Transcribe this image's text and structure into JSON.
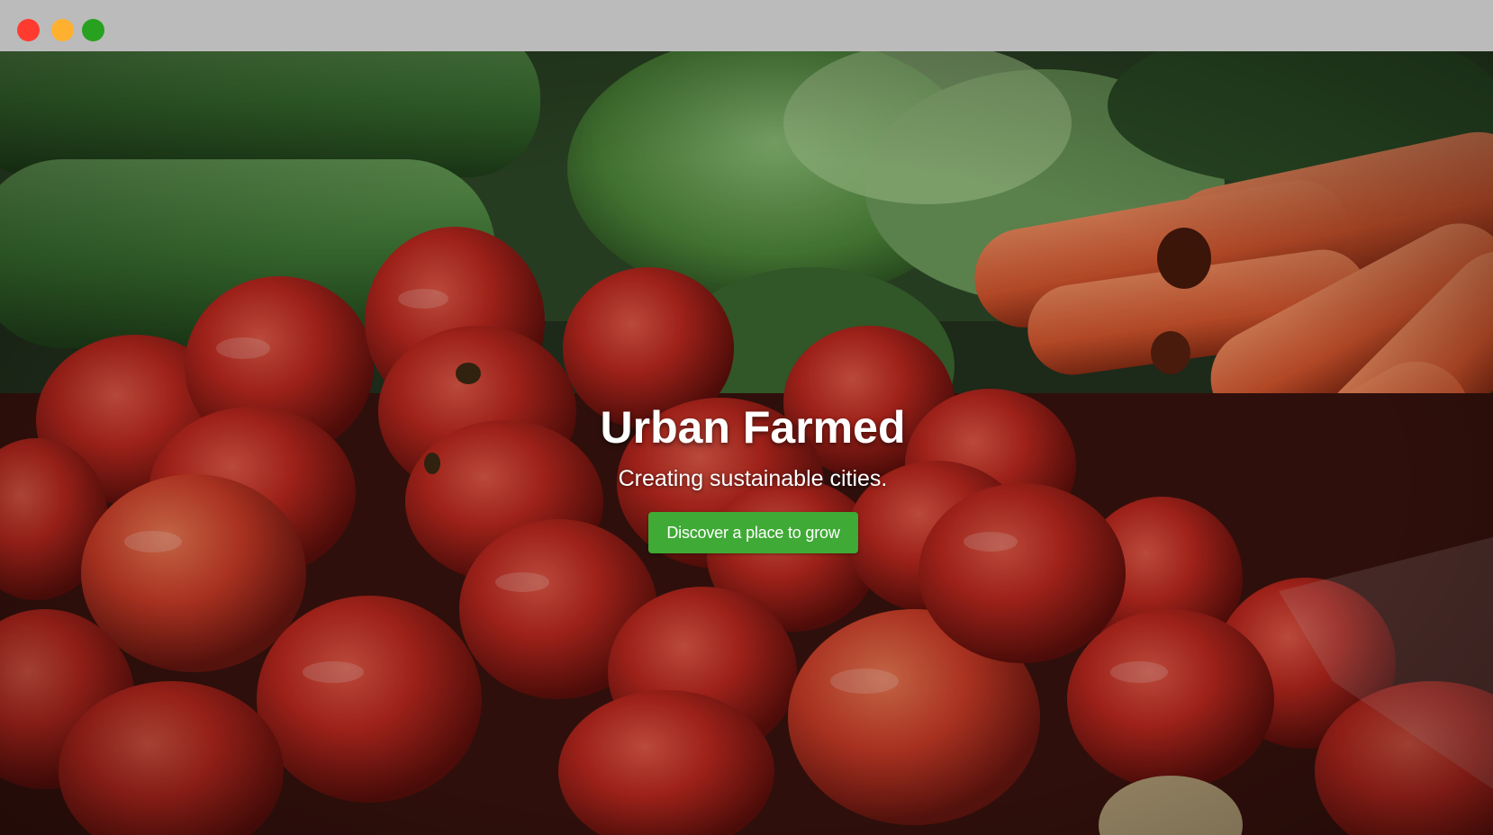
{
  "window": {
    "controls": [
      {
        "name": "close",
        "color": "#ff3b30"
      },
      {
        "name": "minimize",
        "color": "#ffb02e"
      },
      {
        "name": "maximize",
        "color": "#27a11f"
      }
    ]
  },
  "hero": {
    "title": "Urban Farmed",
    "subtitle": "Creating sustainable cities.",
    "cta_label": "Discover a place to grow",
    "background_subject": "produce-photo",
    "colors": {
      "cta": "#3faa35",
      "tomato": "#c62f24",
      "carrot": "#e0653c",
      "greens": "#4f8a3b"
    }
  }
}
